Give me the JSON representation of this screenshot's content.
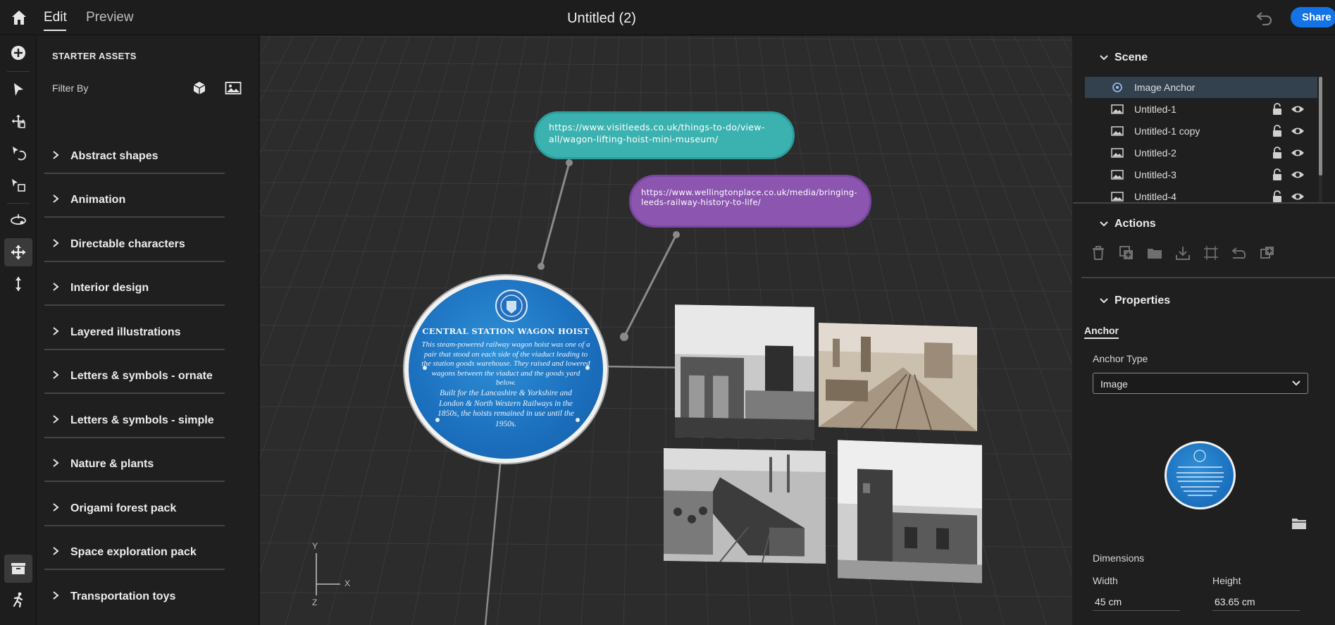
{
  "app": {
    "tabs": {
      "edit": "Edit",
      "preview": "Preview"
    },
    "title": "Untitled (2)",
    "share_label": "Share",
    "accent": "#1473e6"
  },
  "tools": [
    "add-icon",
    "select-icon",
    "move-icon",
    "rotate-icon",
    "scale-icon",
    "orbit-icon",
    "pan-icon",
    "dolly-icon",
    "assets-icon",
    "actions-icon"
  ],
  "assets": {
    "title": "STARTER ASSETS",
    "filter_label": "Filter By",
    "categories": [
      "Abstract shapes",
      "Animation",
      "Directable characters",
      "Interior design",
      "Layered illustrations",
      "Letters & symbols - ornate",
      "Letters & symbols - simple",
      "Nature & plants",
      "Origami forest pack",
      "Space exploration pack",
      "Transportation toys"
    ]
  },
  "viewport": {
    "bubble_teal": "https://www.visitleeds.co.uk/things-to-do/view-all/wagon-lifting-hoist-mini-museum/",
    "bubble_purple": "https://www.wellingtonplace.co.uk/media/bringing-leeds-railway-history-to-life/",
    "plaque": {
      "heading": "CENTRAL STATION WAGON HOIST",
      "body": "This steam-powered railway wagon hoist was one of a pair that stood on each side of the viaduct leading to the station goods warehouse. They raised and lowered wagons between the viaduct and the goods yard below.",
      "footer": "Built for the Lancashire & Yorkshire and London & North Western Railways in the 1850s, the hoists remained in use until the 1950s."
    },
    "axes": {
      "y": "Y",
      "x": "X",
      "z": "Z"
    }
  },
  "scene": {
    "title": "Scene",
    "items": [
      {
        "label": "Image Anchor",
        "selected": true
      },
      {
        "label": "Untitled-1"
      },
      {
        "label": "Untitled-1 copy"
      },
      {
        "label": "Untitled-2"
      },
      {
        "label": "Untitled-3"
      },
      {
        "label": "Untitled-4"
      }
    ]
  },
  "actions": {
    "title": "Actions",
    "icons": [
      "delete-icon",
      "duplicate-icon",
      "group-icon",
      "import-icon",
      "fit-icon",
      "reset-icon",
      "replace-icon"
    ]
  },
  "properties": {
    "title": "Properties",
    "tab": "Anchor",
    "anchor_type_label": "Anchor Type",
    "anchor_type_value": "Image",
    "dimensions_label": "Dimensions",
    "width_label": "Width",
    "width_value": "45 cm",
    "height_label": "Height",
    "height_value": "63.65 cm"
  }
}
